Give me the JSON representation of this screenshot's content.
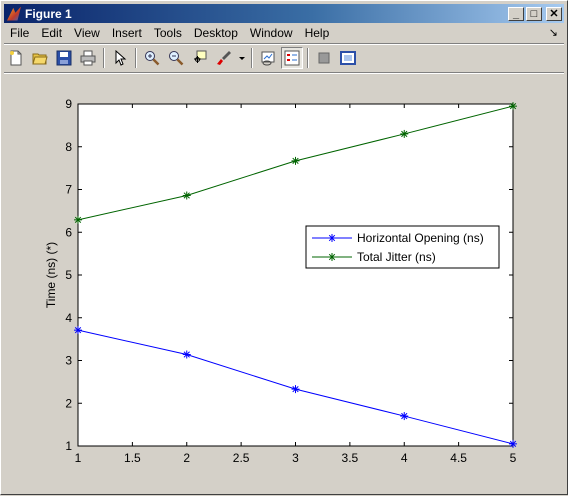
{
  "window": {
    "title": "Figure 1",
    "min_label": "_",
    "max_label": "□",
    "close_label": "✕"
  },
  "menubar": {
    "items": [
      "File",
      "Edit",
      "View",
      "Insert",
      "Tools",
      "Desktop",
      "Window",
      "Help"
    ],
    "dock_arrow": "↘"
  },
  "toolbar": {
    "buttons": [
      {
        "name": "new-figure-icon"
      },
      {
        "name": "open-file-icon"
      },
      {
        "name": "save-icon"
      },
      {
        "name": "print-icon"
      },
      {
        "name": "edit-plot-arrow-icon"
      },
      {
        "name": "zoom-in-icon"
      },
      {
        "name": "zoom-out-icon"
      },
      {
        "name": "pan-data-cursor-icon"
      },
      {
        "name": "brush-icon"
      },
      {
        "name": "brush-dropdown-icon"
      },
      {
        "name": "link-plot-icon"
      },
      {
        "name": "insert-legend-icon"
      },
      {
        "name": "hide-plot-tools-icon"
      },
      {
        "name": "show-plot-tools-icon"
      }
    ]
  },
  "colors": {
    "series1": "#0000ff",
    "series2": "#006400"
  },
  "chart_data": {
    "type": "line",
    "title": "",
    "xlabel": "",
    "ylabel": "Time (ns) (*)",
    "xlim": [
      1,
      5
    ],
    "ylim": [
      1,
      9
    ],
    "xticks": [
      1,
      1.5,
      2,
      2.5,
      3,
      3.5,
      4,
      4.5,
      5
    ],
    "yticks": [
      1,
      2,
      3,
      4,
      5,
      6,
      7,
      8,
      9
    ],
    "x": [
      1,
      2,
      3,
      4,
      5
    ],
    "series": [
      {
        "name": "Horizontal Opening (ns)",
        "values": [
          3.71,
          3.14,
          2.33,
          1.7,
          1.05
        ],
        "color": "#0000ff",
        "marker": "*"
      },
      {
        "name": "Total Jitter (ns)",
        "values": [
          6.29,
          6.86,
          7.67,
          8.3,
          8.95
        ],
        "color": "#006400",
        "marker": "*"
      }
    ],
    "grid": false,
    "legend_position": "right-center"
  }
}
